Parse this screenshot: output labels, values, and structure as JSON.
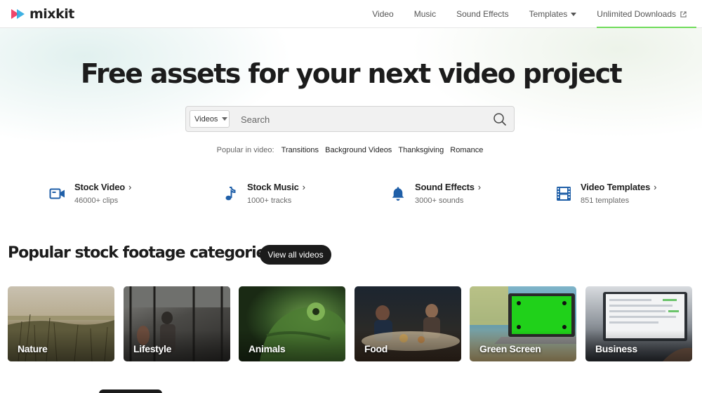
{
  "brand": {
    "name": "mixkit"
  },
  "nav": {
    "items": [
      {
        "label": "Video"
      },
      {
        "label": "Music"
      },
      {
        "label": "Sound Effects"
      },
      {
        "label": "Templates",
        "has_dropdown": true
      },
      {
        "label": "Unlimited Downloads",
        "external": true
      }
    ],
    "accent_color": "#6fdc5a"
  },
  "hero": {
    "title": "Free assets for your next video project",
    "search": {
      "type_select_value": "Videos",
      "placeholder": "Search",
      "value": ""
    },
    "popular_label": "Popular in video:",
    "popular_tags": [
      "Transitions",
      "Background Videos",
      "Thanksgiving",
      "Romance"
    ]
  },
  "stats": [
    {
      "title": "Stock Video",
      "subtitle": "46000+ clips",
      "icon": "video-camera-icon"
    },
    {
      "title": "Stock Music",
      "subtitle": "1000+ tracks",
      "icon": "music-note-icon"
    },
    {
      "title": "Sound Effects",
      "subtitle": "3000+ sounds",
      "icon": "bell-icon"
    },
    {
      "title": "Video Templates",
      "subtitle": "851 templates",
      "icon": "film-strip-icon"
    }
  ],
  "categories": {
    "title": "Popular stock footage categories",
    "view_all_label": "View all videos",
    "items": [
      {
        "label": "Nature"
      },
      {
        "label": "Lifestyle"
      },
      {
        "label": "Animals"
      },
      {
        "label": "Food"
      },
      {
        "label": "Green Screen"
      },
      {
        "label": "Business"
      }
    ]
  },
  "colors": {
    "icon_blue": "#1f5fa8",
    "dark": "#1b1b1b"
  }
}
